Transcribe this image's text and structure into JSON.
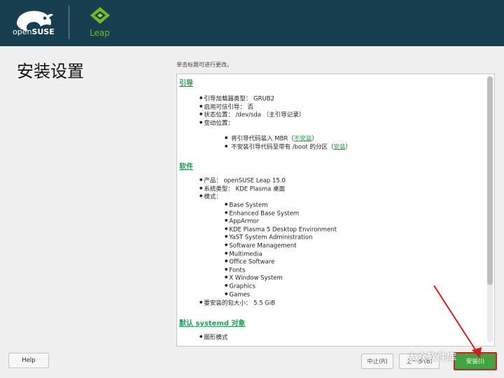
{
  "header": {
    "brand_prefix": "open",
    "brand_bold": "SUSE",
    "product": "Leap",
    "colors": {
      "bar": "#173f4f",
      "accent": "#73ba25"
    }
  },
  "page": {
    "title": "安装设置",
    "hint": "单击标题可进行更改。"
  },
  "sections": {
    "boot": {
      "title": "引导",
      "items": [
        "引导加载器类型： GRUB2",
        "启用可信引导： 否",
        "状态位置： /dev/sda （主引导记录）",
        "变动位置："
      ],
      "sub": [
        {
          "text": "将引导代码装入 MBR（",
          "link": "不安装",
          "tail": "）"
        },
        {
          "text": "不安装引导代码至带有 /boot 的分区（",
          "link": "安装",
          "tail": "）"
        }
      ]
    },
    "software": {
      "title": "软件",
      "items": [
        "产品： openSUSE Leap 15.0",
        "系统类型： KDE Plasma 桌面",
        "模式："
      ],
      "patterns": [
        "Base System",
        "Enhanced Base System",
        "AppArmor",
        "KDE Plasma 5 Desktop Environment",
        "YaST System Administration",
        "Software Management",
        "Multimedia",
        "Office Software",
        "Fonts",
        "X Window System",
        "Graphics",
        "Games"
      ],
      "size": "要安装的包大小： 5.5 GiB"
    },
    "systemd": {
      "title": "默认 systemd 对象",
      "items": [
        "图形模式"
      ]
    }
  },
  "buttons": {
    "help": "Help",
    "abort": "中止(R)",
    "back": "上一步(B)",
    "next": "安装(I)"
  },
  "watermark": "大众软件库"
}
